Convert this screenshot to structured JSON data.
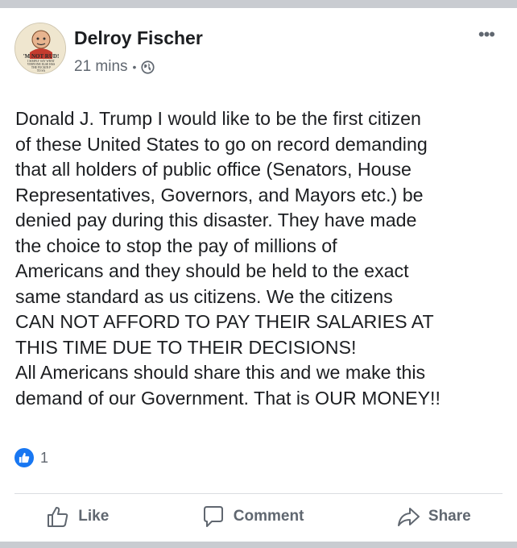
{
  "post": {
    "author": "Delroy Fischer",
    "timestamp": "21 mins",
    "separator": "•",
    "privacy_icon": "globe-icon",
    "more_icon": "•••",
    "avatar_text": [
      "'M NOT RUD!",
      "I SIMPLY SAY WHAT",
      "VERYONE ELSE HAS",
      "THE FUCKIN P",
      "TO SA"
    ],
    "lines": [
      "Donald J. Trump I would like to be the first citizen",
      "of these United States to go on record demanding",
      "that all holders of public office (Senators, House",
      "Representatives, Governors, and Mayors etc.) be",
      "denied pay during this disaster. They have made",
      "the choice to stop the pay of millions of",
      "Americans and they should be held to the exact",
      "same standard as us citizens. We the citizens",
      "CAN NOT AFFORD TO PAY THEIR SALARIES AT",
      "THIS TIME DUE TO THEIR DECISIONS!",
      "All Americans should share this and we make this",
      "demand of our Government. That is OUR MONEY!!"
    ]
  },
  "reactions": {
    "count": "1",
    "icon": "like-icon",
    "color": "#1877f2"
  },
  "actions": {
    "like_label": "Like",
    "comment_label": "Comment",
    "share_label": "Share"
  }
}
